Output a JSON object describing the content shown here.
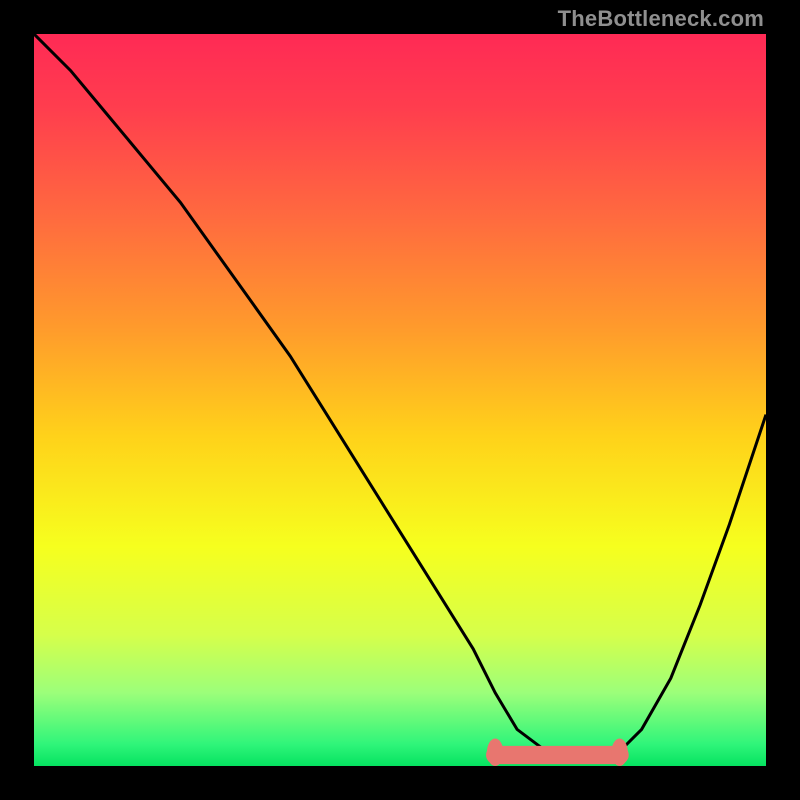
{
  "watermark": "TheBottleneck.com",
  "chart_data": {
    "type": "line",
    "title": "",
    "xlabel": "",
    "ylabel": "",
    "xlim": [
      0,
      100
    ],
    "ylim": [
      0,
      100
    ],
    "grid": false,
    "legend": false,
    "background_gradient": {
      "stops": [
        {
          "offset": 0.0,
          "color": "#ff2a55"
        },
        {
          "offset": 0.1,
          "color": "#ff3d4e"
        },
        {
          "offset": 0.25,
          "color": "#ff6a3f"
        },
        {
          "offset": 0.4,
          "color": "#ff9a2c"
        },
        {
          "offset": 0.55,
          "color": "#ffd21a"
        },
        {
          "offset": 0.7,
          "color": "#f6ff1e"
        },
        {
          "offset": 0.82,
          "color": "#d6ff4a"
        },
        {
          "offset": 0.9,
          "color": "#9cff7a"
        },
        {
          "offset": 0.97,
          "color": "#30f57a"
        },
        {
          "offset": 1.0,
          "color": "#05e360"
        }
      ]
    },
    "series": [
      {
        "name": "bottleneck-curve",
        "color": "#000000",
        "x": [
          0,
          5,
          10,
          15,
          20,
          25,
          30,
          35,
          40,
          45,
          50,
          55,
          60,
          63,
          66,
          70,
          74,
          78,
          80,
          83,
          87,
          91,
          95,
          100
        ],
        "values": [
          100,
          95,
          89,
          83,
          77,
          70,
          63,
          56,
          48,
          40,
          32,
          24,
          16,
          10,
          5,
          2,
          1,
          1,
          2,
          5,
          12,
          22,
          33,
          48
        ]
      }
    ],
    "highlight_band": {
      "name": "optimal-range",
      "color": "#e8766f",
      "x_start": 63,
      "x_end": 80,
      "y": 1.5,
      "thickness": 2.5
    }
  }
}
